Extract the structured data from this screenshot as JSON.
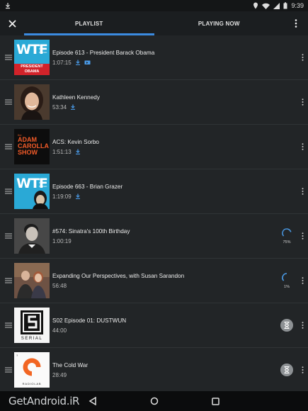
{
  "status_bar": {
    "time": "9:39"
  },
  "tabs": [
    {
      "label": "PLAYLIST",
      "active": true
    },
    {
      "label": "PLAYING NOW",
      "active": false
    }
  ],
  "episodes": [
    {
      "title": "Episode 613 - President Barack Obama",
      "duration": "1:07:15",
      "status": "downloaded",
      "art_text": "WTF",
      "art_sub": "with marc maron",
      "art_band": "PRESIDENT OBAMA"
    },
    {
      "title": "Kathleen Kennedy",
      "duration": "53:34",
      "status": "downloaded"
    },
    {
      "title": "ACS: Kevin Sorbo",
      "duration": "1:51:13",
      "status": "downloaded",
      "art_top": "the",
      "art_main": "ADAM CAROLLA SHOW"
    },
    {
      "title": "Episode 663 - Brian Grazer",
      "duration": "1:19:09",
      "status": "downloaded",
      "art_text": "WTF",
      "art_sub": "with marc maron"
    },
    {
      "title": "#574: Sinatra's 100th Birthday",
      "duration": "1:00:19",
      "status": "downloading",
      "progress_label": "75%",
      "progress": 0.75
    },
    {
      "title": "Expanding Our Perspectives, with Susan Sarandon",
      "duration": "56:48",
      "status": "downloading",
      "progress_label": "1%",
      "progress": 0.01
    },
    {
      "title": "S02 Episode 01: DUSTWUN",
      "duration": "44:00",
      "status": "queued",
      "art_label": "SERIAL"
    },
    {
      "title": "The Cold War",
      "duration": "28:49",
      "status": "queued",
      "art_label": "RADIOLAB",
      "art_top": "?"
    }
  ],
  "watermark": "GetAndroid.iR",
  "colors": {
    "accent": "#3b8be0",
    "background": "#222527",
    "app_bar": "#1b1e20"
  }
}
